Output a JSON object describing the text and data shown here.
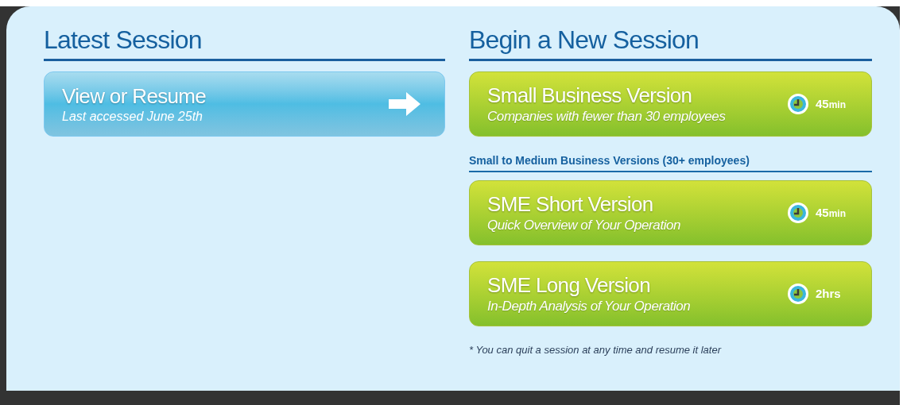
{
  "latest": {
    "heading": "Latest Session",
    "resume": {
      "title": "View or Resume",
      "subtitle": "Last accessed June 25th"
    }
  },
  "new_session": {
    "heading": "Begin a New Session",
    "items": [
      {
        "kind": "option",
        "title": "Small Business Version",
        "subtitle": "Companies with fewer than 30 employees",
        "duration": "45",
        "unit": "min"
      },
      {
        "kind": "subheading",
        "text": "Small to Medium Business Versions (30+ employees)"
      },
      {
        "kind": "option",
        "title": "SME Short Version",
        "subtitle": "Quick Overview of Your Operation",
        "duration": "45",
        "unit": "min"
      },
      {
        "kind": "option",
        "title": "SME Long Version",
        "subtitle": "In-Depth Analysis of Your Operation",
        "duration": "2hrs"
      }
    ],
    "note": "* You can quit a session at any time and resume it later"
  }
}
